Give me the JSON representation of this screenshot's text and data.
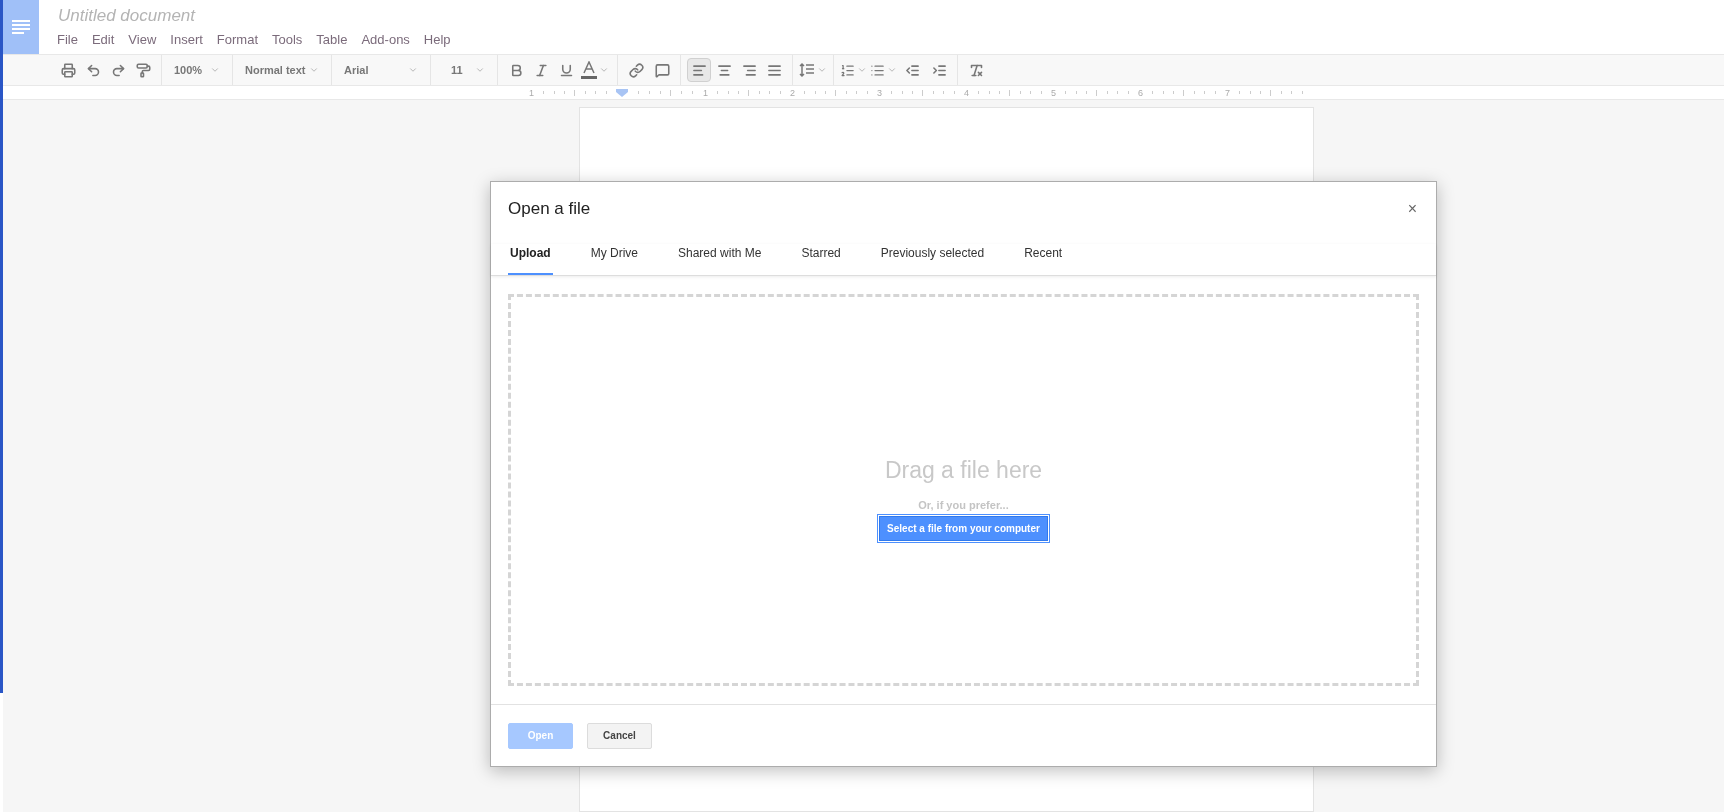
{
  "document": {
    "title": "Untitled document"
  },
  "menu": [
    "File",
    "Edit",
    "View",
    "Insert",
    "Format",
    "Tools",
    "Table",
    "Add-ons",
    "Help"
  ],
  "toolbar": {
    "zoom": "100%",
    "style": "Normal text",
    "font": "Arial",
    "size": "11",
    "alignments": [
      {
        "kind": "left",
        "selected": true
      },
      {
        "kind": "center",
        "selected": false
      },
      {
        "kind": "right",
        "selected": false
      },
      {
        "kind": "justify",
        "selected": false
      }
    ]
  },
  "ruler": [
    "1",
    "1",
    "2",
    "3",
    "4",
    "5",
    "6",
    "7"
  ],
  "dialog": {
    "title": "Open a file",
    "close": "×",
    "tabs": [
      {
        "label": "Upload",
        "selected": true
      },
      {
        "label": "My Drive",
        "selected": false
      },
      {
        "label": "Shared with Me",
        "selected": false
      },
      {
        "label": "Starred",
        "selected": false
      },
      {
        "label": "Previously selected",
        "selected": false
      },
      {
        "label": "Recent",
        "selected": false
      }
    ],
    "dropzone": {
      "heading": "Drag a file here",
      "hint": "Or, if you prefer...",
      "button": "Select a file from your computer"
    },
    "buttons": [
      {
        "label": "Open",
        "kind": "primary",
        "disabled": true
      },
      {
        "label": "Cancel",
        "kind": "secondary",
        "disabled": false
      }
    ]
  }
}
